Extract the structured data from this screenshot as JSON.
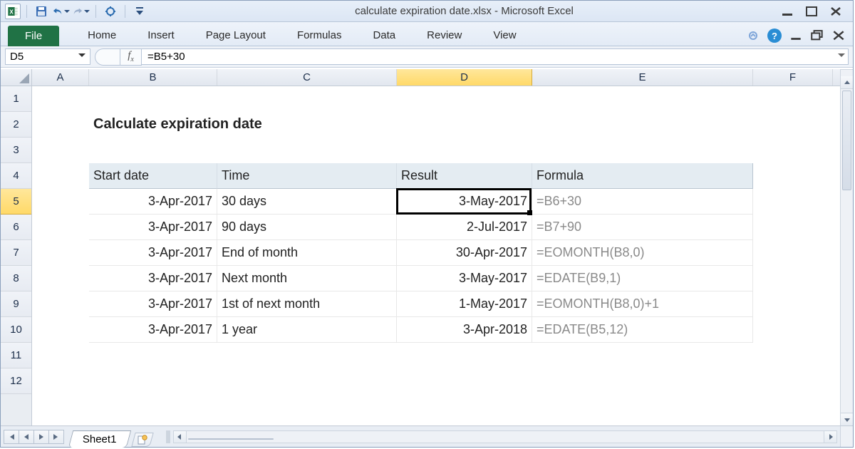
{
  "window": {
    "title": "calculate expiration date.xlsx - Microsoft Excel"
  },
  "ribbon": {
    "file": "File",
    "tabs": [
      "Home",
      "Insert",
      "Page Layout",
      "Formulas",
      "Data",
      "Review",
      "View"
    ]
  },
  "namebox": {
    "value": "D5"
  },
  "formulabar": {
    "value": "=B5+30"
  },
  "columns": [
    "A",
    "B",
    "C",
    "D",
    "E",
    "F"
  ],
  "rows": [
    "1",
    "2",
    "3",
    "4",
    "5",
    "6",
    "7",
    "8",
    "9",
    "10",
    "11",
    "12"
  ],
  "activeRow": "5",
  "activeCol": "D",
  "content": {
    "title": "Calculate expiration date",
    "headers": {
      "b": "Start date",
      "c": "Time",
      "d": "Result",
      "e": "Formula"
    },
    "data": [
      {
        "b": "3-Apr-2017",
        "c": "30 days",
        "d": "3-May-2017",
        "e": "=B6+30"
      },
      {
        "b": "3-Apr-2017",
        "c": "90 days",
        "d": "2-Jul-2017",
        "e": "=B7+90"
      },
      {
        "b": "3-Apr-2017",
        "c": "End of month",
        "d": "30-Apr-2017",
        "e": "=EOMONTH(B8,0)"
      },
      {
        "b": "3-Apr-2017",
        "c": "Next month",
        "d": "3-May-2017",
        "e": "=EDATE(B9,1)"
      },
      {
        "b": "3-Apr-2017",
        "c": "1st of next month",
        "d": "1-May-2017",
        "e": "=EOMONTH(B8,0)+1"
      },
      {
        "b": "3-Apr-2017",
        "c": "1 year",
        "d": "3-Apr-2018",
        "e": "=EDATE(B5,12)"
      }
    ]
  },
  "sheets": {
    "active": "Sheet1"
  },
  "chart_data": {
    "type": "table",
    "title": "Calculate expiration date",
    "columns": [
      "Start date",
      "Time",
      "Result",
      "Formula"
    ],
    "rows": [
      [
        "3-Apr-2017",
        "30 days",
        "3-May-2017",
        "=B6+30"
      ],
      [
        "3-Apr-2017",
        "90 days",
        "2-Jul-2017",
        "=B7+90"
      ],
      [
        "3-Apr-2017",
        "End of month",
        "30-Apr-2017",
        "=EOMONTH(B8,0)"
      ],
      [
        "3-Apr-2017",
        "Next month",
        "3-May-2017",
        "=EDATE(B9,1)"
      ],
      [
        "3-Apr-2017",
        "1st of next month",
        "1-May-2017",
        "=EOMONTH(B8,0)+1"
      ],
      [
        "3-Apr-2017",
        "1 year",
        "3-Apr-2018",
        "=EDATE(B5,12)"
      ]
    ]
  }
}
